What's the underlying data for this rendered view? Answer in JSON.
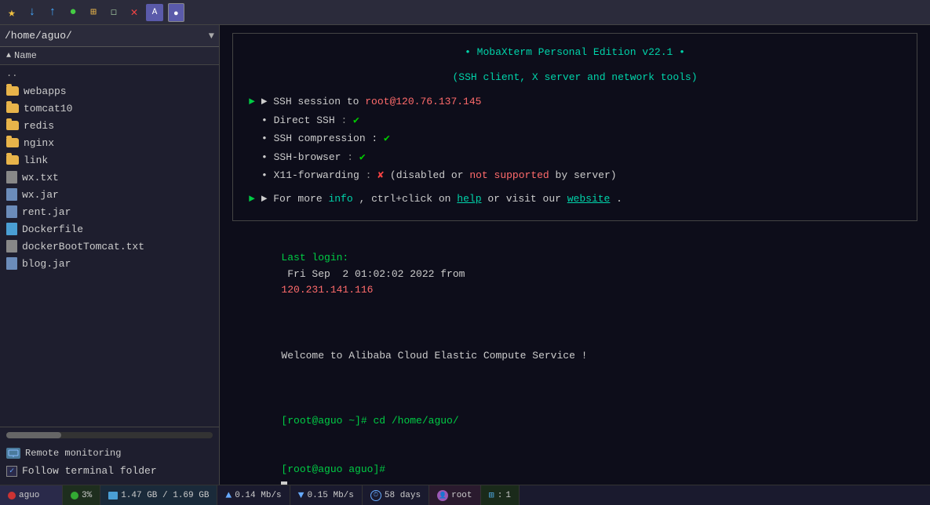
{
  "toolbar": {
    "icons": [
      "★",
      "↓",
      "↑",
      "◉",
      "⊞",
      "◻",
      "✕",
      "✦"
    ]
  },
  "sidebar": {
    "path": "/home/aguo/",
    "header_label": "Name",
    "header_sort": "▲",
    "files": [
      {
        "name": "..",
        "type": "dotdot"
      },
      {
        "name": "webapps",
        "type": "folder"
      },
      {
        "name": "tomcat10",
        "type": "folder"
      },
      {
        "name": "redis",
        "type": "folder"
      },
      {
        "name": "nginx",
        "type": "folder"
      },
      {
        "name": "link",
        "type": "folder"
      },
      {
        "name": "wx.txt",
        "type": "txt"
      },
      {
        "name": "wx.jar",
        "type": "jar"
      },
      {
        "name": "rent.jar",
        "type": "jar"
      },
      {
        "name": "Dockerfile",
        "type": "docker"
      },
      {
        "name": "dockerBootTomcat.txt",
        "type": "txt"
      },
      {
        "name": "blog.jar",
        "type": "jar"
      }
    ],
    "remote_monitoring": "Remote monitoring",
    "follow_terminal": "Follow terminal folder"
  },
  "terminal": {
    "welcome_title": "• MobaXterm Personal Edition v22.1 •",
    "welcome_subtitle": "(SSH client, X server and network tools)",
    "ssh_session_prefix": "► SSH session to ",
    "ssh_host": "root@120.76.137.145",
    "direct_ssh": "• Direct SSH",
    "direct_ssh_colon": ":",
    "ssh_compression": "• SSH compression :",
    "ssh_browser": "• SSH-browser",
    "ssh_browser_colon": ":",
    "x11_forwarding": "• X11-forwarding",
    "x11_colon": ":",
    "x11_disabled": "(disabled or ",
    "x11_not_supported": "not supported",
    "x11_by_server": " by server)",
    "more_info_prefix": "► For more ",
    "more_info_word": "info",
    "more_info_mid": ", ctrl+click on ",
    "more_info_help": "help",
    "more_info_or": " or visit our ",
    "more_info_website": "website",
    "more_info_end": ".",
    "last_login_label": "Last login:",
    "last_login_date": " Fri Sep  2 01:02:02 2022 from ",
    "last_login_ip": "120.231.141.116",
    "welcome_cloud": "Welcome to Alibaba Cloud Elastic Compute Service !",
    "prompt1": "[root@aguo ~]# cd /home/aguo/",
    "prompt2": "[root@aguo aguo]# "
  },
  "statusbar": {
    "aguo": "aguo",
    "cpu_percent": "3%",
    "memory": "1.47 GB / 1.69 GB",
    "net_up": "0.14 Mb/s",
    "net_down": "0.15 Mb/s",
    "uptime": "58 days",
    "user": "root",
    "session": "1"
  }
}
